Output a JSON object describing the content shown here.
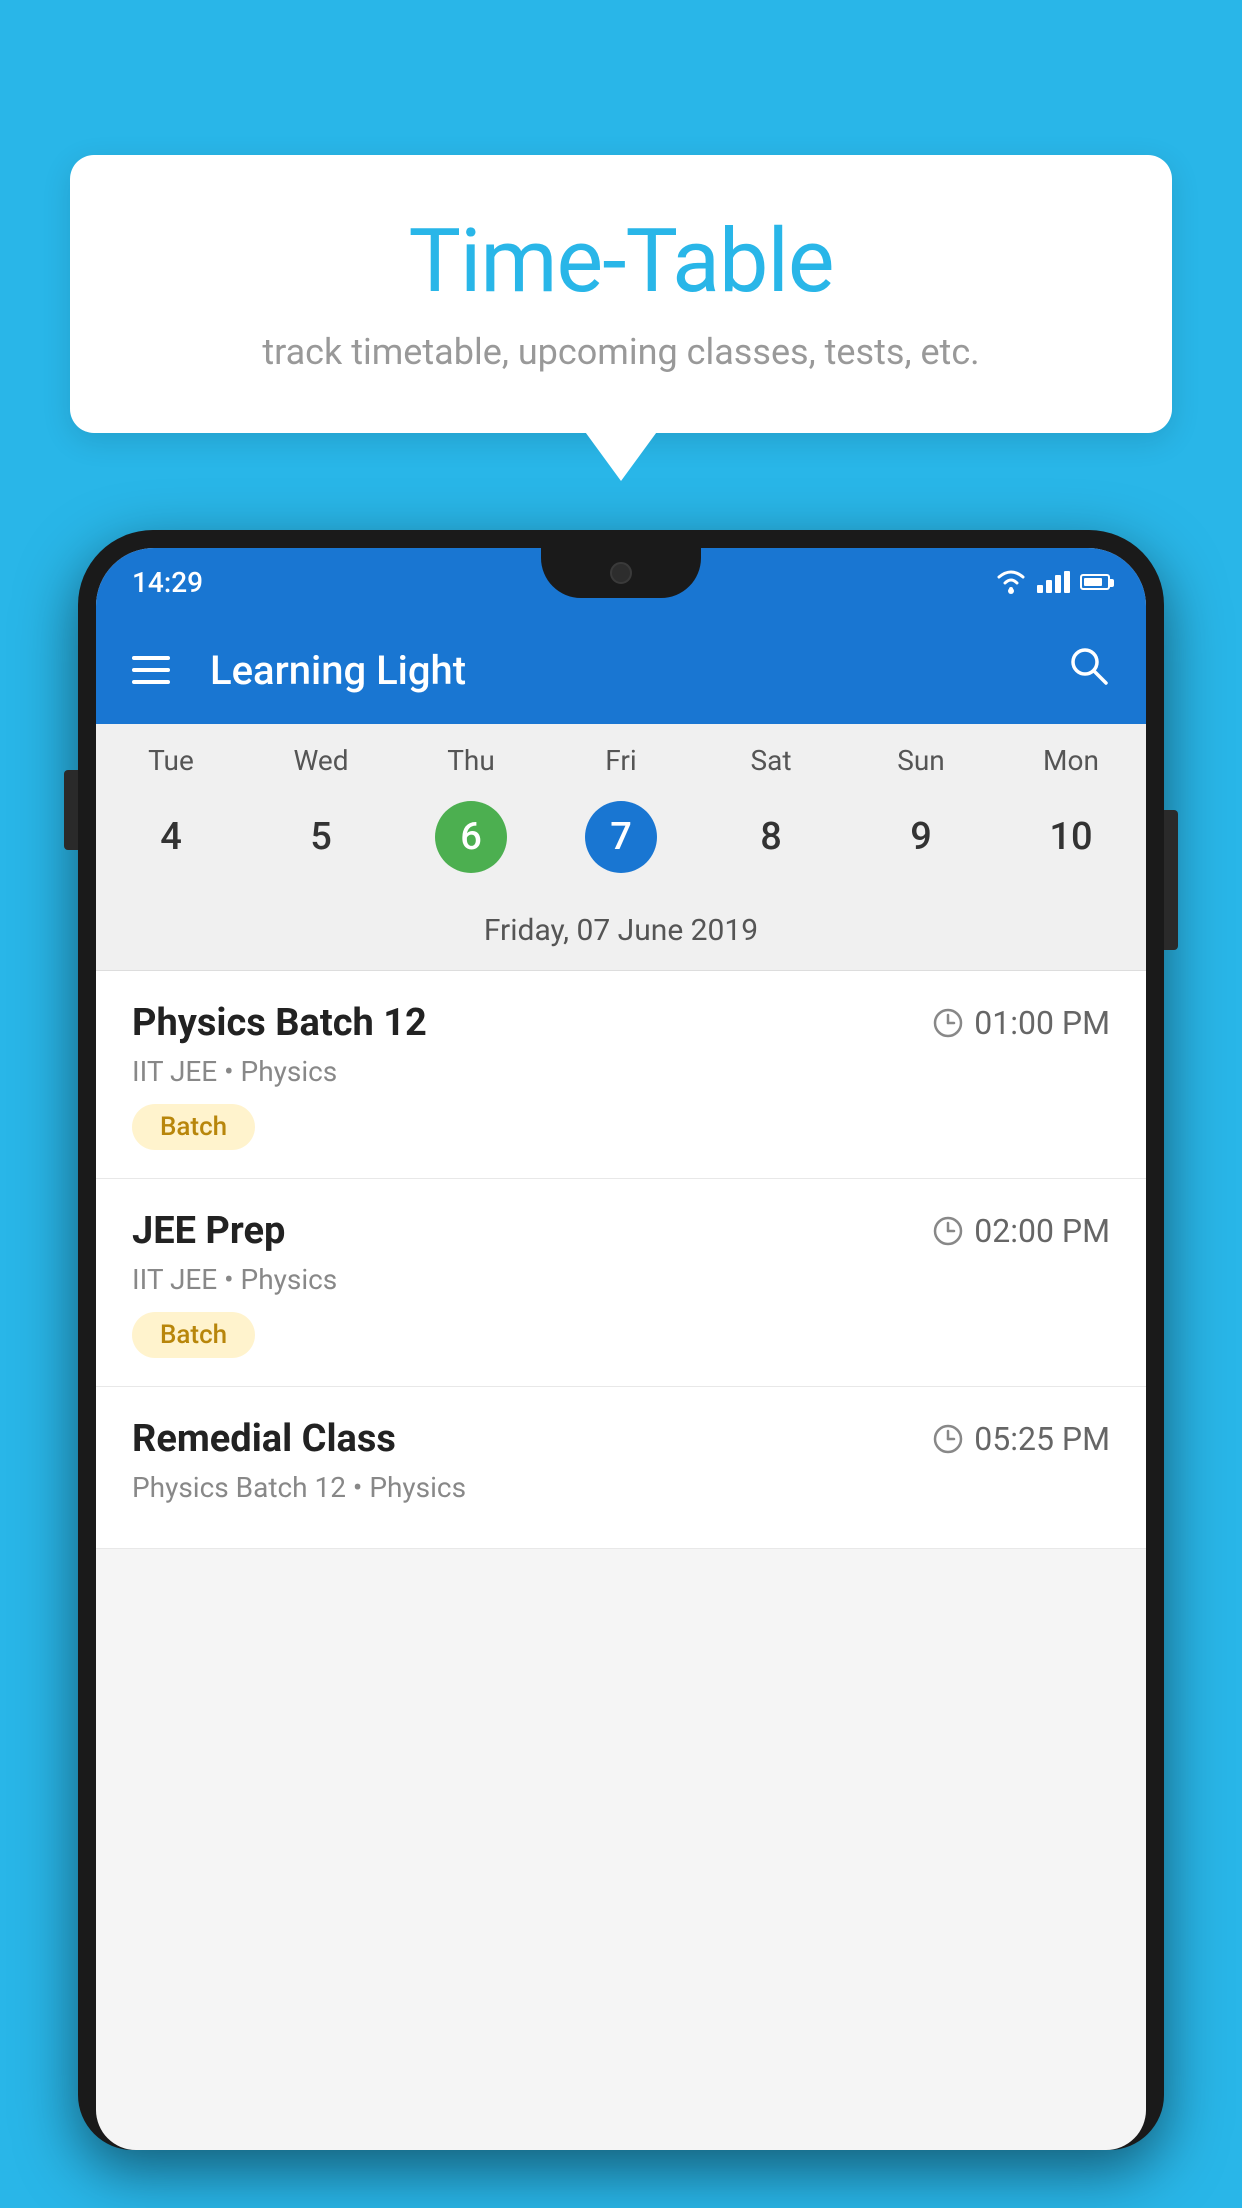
{
  "background_color": "#29b6e8",
  "speech_bubble": {
    "title": "Time-Table",
    "subtitle": "track timetable, upcoming classes, tests, etc."
  },
  "phone": {
    "status_bar": {
      "time": "14:29"
    },
    "app_bar": {
      "title": "Learning Light"
    },
    "calendar": {
      "days": [
        "Tue",
        "Wed",
        "Thu",
        "Fri",
        "Sat",
        "Sun",
        "Mon"
      ],
      "dates": [
        {
          "number": "4",
          "state": "normal"
        },
        {
          "number": "5",
          "state": "normal"
        },
        {
          "number": "6",
          "state": "today"
        },
        {
          "number": "7",
          "state": "selected"
        },
        {
          "number": "8",
          "state": "normal"
        },
        {
          "number": "9",
          "state": "normal"
        },
        {
          "number": "10",
          "state": "normal"
        }
      ],
      "selected_date_label": "Friday, 07 June 2019"
    },
    "schedule": [
      {
        "name": "Physics Batch 12",
        "time": "01:00 PM",
        "subtitle": "IIT JEE • Physics",
        "tag": "Batch"
      },
      {
        "name": "JEE Prep",
        "time": "02:00 PM",
        "subtitle": "IIT JEE • Physics",
        "tag": "Batch"
      },
      {
        "name": "Remedial Class",
        "time": "05:25 PM",
        "subtitle": "Physics Batch 12 • Physics",
        "tag": ""
      }
    ]
  }
}
